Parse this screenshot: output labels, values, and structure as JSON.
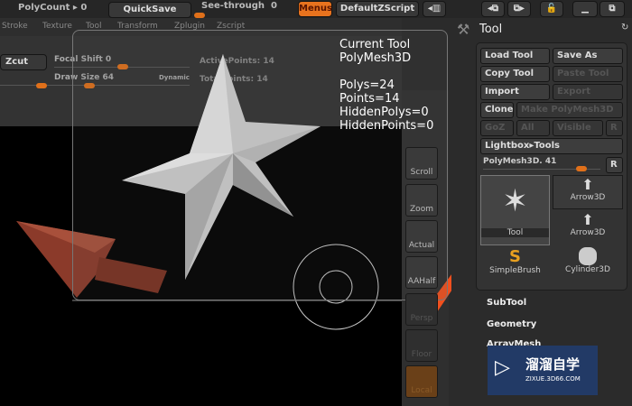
{
  "topbar": {
    "polycount_label": "PolyCount",
    "polycount_value": "0",
    "quicksave": "QuickSave",
    "see_through_label": "See-through",
    "see_through_value": "0",
    "menus": "Menus",
    "script": "DefaultZScript"
  },
  "menu": [
    "Stroke",
    "Texture",
    "Tool",
    "Transform",
    "Zplugin",
    "Zscript"
  ],
  "controls": {
    "zcut": "Zcut",
    "focal_shift": "Focal Shift 0",
    "draw_size": "Draw Size 64",
    "dynamic": "Dynamic",
    "active_points": "ActivePoints: 14",
    "total_points": "TotalPoints: 14"
  },
  "info": {
    "title": "Current Tool",
    "tool": "PolyMesh3D",
    "polys": "Polys=24",
    "points": "Points=14",
    "hidden_polys": "HiddenPolys=0",
    "hidden_points": "HiddenPoints=0"
  },
  "shelf": [
    "Scroll",
    "Zoom",
    "Actual",
    "AAHalf",
    "Persp",
    "Floor",
    "Local"
  ],
  "panel": {
    "title": "Tool",
    "load": "Load Tool",
    "save_as": "Save As",
    "copy": "Copy Tool",
    "paste": "Paste Tool",
    "import": "Import",
    "export": "Export",
    "clone": "Clone",
    "make": "Make PolyMesh3D",
    "goz": "GoZ",
    "all": "All",
    "visible": "Visible",
    "r": "R",
    "lightbox": "Lightbox▸Tools",
    "slider_label": "PolyMesh3D. 41",
    "thumbs": [
      "Tool",
      "Arrow3D",
      "Arrow3D",
      "SimpleBrush",
      "Cylinder3D"
    ],
    "sections": [
      "SubTool",
      "Geometry",
      "ArrayMesh"
    ]
  },
  "watermark": {
    "cn": "溜溜自学",
    "url": "ZIXUE.3D66.COM"
  }
}
